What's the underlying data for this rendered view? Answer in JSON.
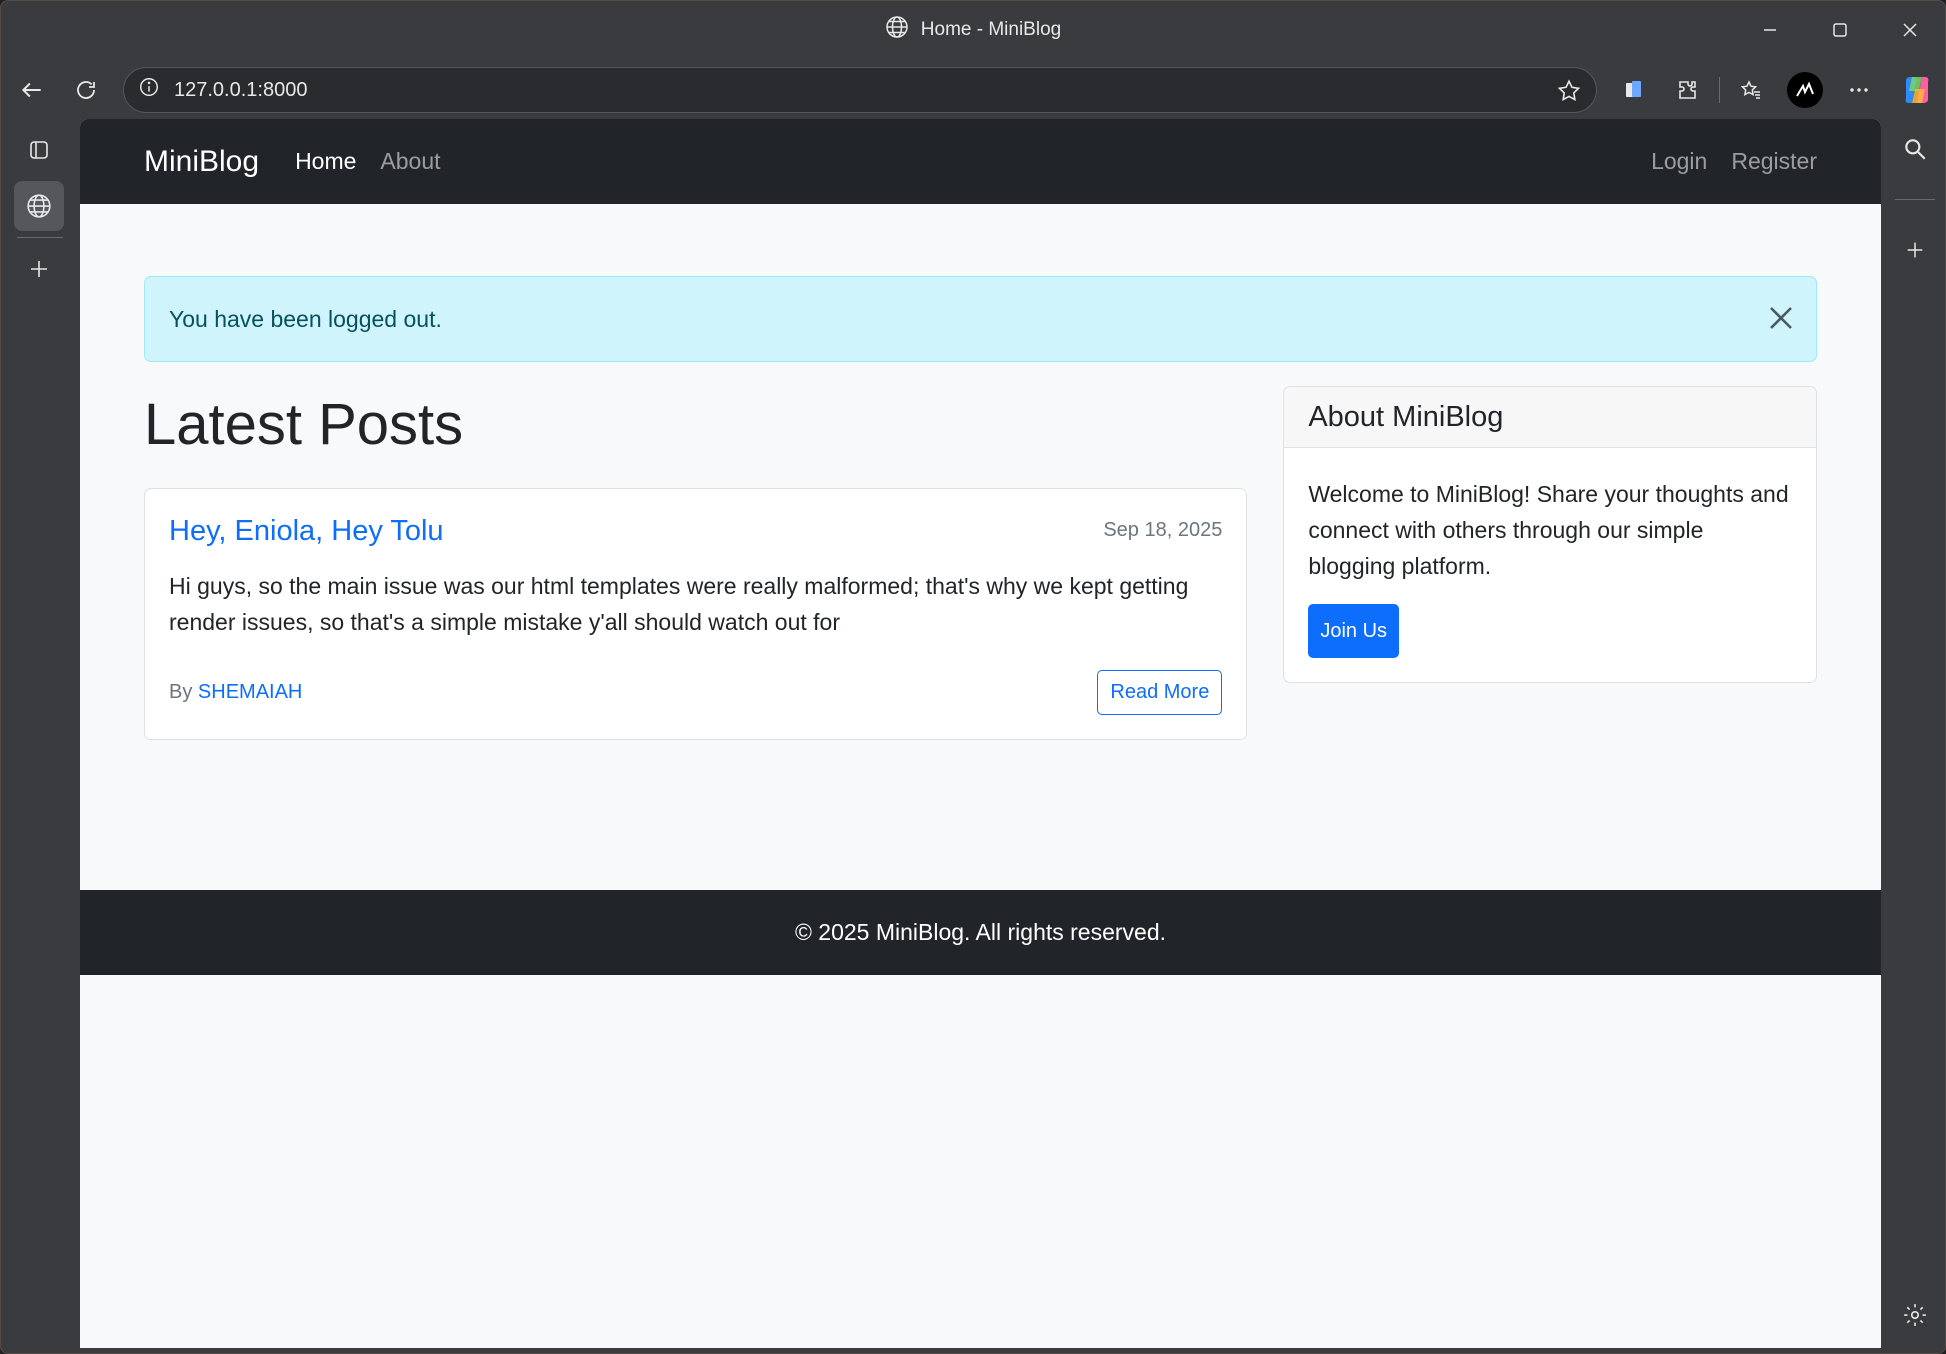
{
  "browser": {
    "tab_title": "Home - MiniBlog",
    "url": "127.0.0.1:8000"
  },
  "site": {
    "brand": "MiniBlog",
    "nav": {
      "home": "Home",
      "about": "About",
      "login": "Login",
      "register": "Register"
    }
  },
  "alert": {
    "message": "You have been logged out."
  },
  "main": {
    "heading": "Latest Posts",
    "posts": [
      {
        "title": "Hey, Eniola, Hey Tolu",
        "date": "Sep 18, 2025",
        "body": "Hi guys, so the main issue was our html templates were really malformed; that's why we kept getting render issues, so that's a simple mistake y'all should watch out for",
        "by_label": "By",
        "author": "SHEMAIAH",
        "read_more": "Read More"
      }
    ]
  },
  "sidebar": {
    "title": "About MiniBlog",
    "text": "Welcome to MiniBlog! Share your thoughts and connect with others through our simple blogging platform.",
    "button": "Join Us"
  },
  "footer": {
    "text": "© 2025 MiniBlog. All rights reserved."
  },
  "colors": {
    "navbar_bg": "#212529",
    "primary": "#0d6efd",
    "alert_bg": "#cff4fc",
    "page_bg": "#f8f9fa"
  }
}
